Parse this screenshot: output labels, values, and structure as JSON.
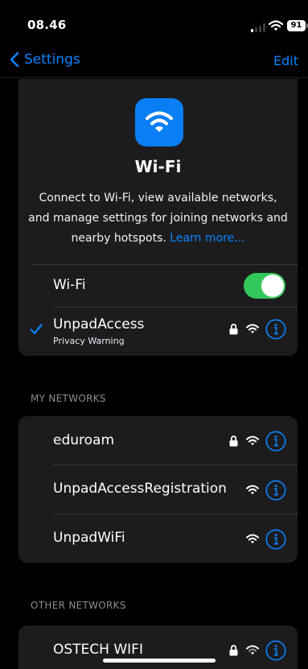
{
  "status_bar": {
    "time": "08.46",
    "battery": "91"
  },
  "nav": {
    "back_label": "Settings",
    "edit_label": "Edit"
  },
  "header": {
    "title": "Wi-Fi",
    "description": "Connect to Wi-Fi, view available networks, and manage settings for joining networks and nearby hotspots.",
    "learn_more": "Learn more..."
  },
  "wifi_toggle": {
    "label": "Wi-Fi",
    "on": true
  },
  "connected": {
    "name": "UnpadAccess",
    "warning": "Privacy Warning",
    "secured": true
  },
  "my_networks": {
    "header": "MY NETWORKS",
    "items": [
      {
        "name": "eduroam",
        "secured": true
      },
      {
        "name": "UnpadAccessRegistration",
        "secured": false
      },
      {
        "name": "UnpadWiFi",
        "secured": false
      }
    ]
  },
  "other_networks": {
    "header": "OTHER NETWORKS",
    "items": [
      {
        "name": "OSTECH WIFI",
        "secured": true
      }
    ]
  },
  "colors": {
    "accent": "#0a84ff",
    "toggle_on": "#34c759",
    "card": "#1c1c1e",
    "background": "#000000"
  }
}
